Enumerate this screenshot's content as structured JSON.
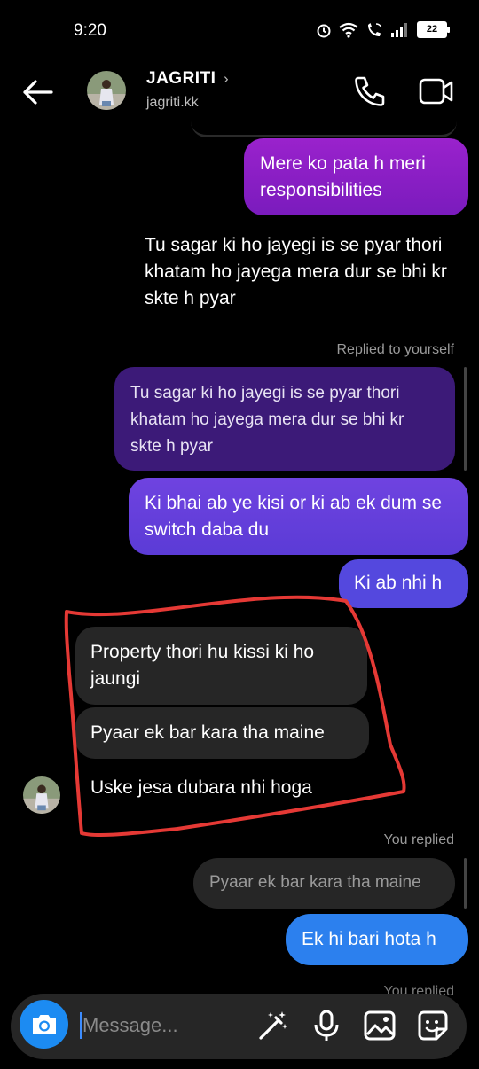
{
  "status_bar": {
    "time": "9:20",
    "battery": "22"
  },
  "header": {
    "name": "JAGRITI",
    "username": "jagriti.kk",
    "chevron": "›"
  },
  "messages": {
    "me1": "Mere ko pata h meri responsibilities",
    "plain": "Tu sagar ki ho jayegi is se pyar thori khatam ho jayega mera dur se bhi kr skte h pyar",
    "replied_to_yourself": "Replied to yourself",
    "quote": "Tu sagar ki ho jayegi is se pyar thori khatam ho jayega mera dur se bhi kr skte h pyar",
    "me2": "Ki bhai ab ye kisi or ki ab ek dum se switch daba du",
    "me3": "Ki ab nhi h",
    "them1": "Property thori hu kissi ki ho jaungi",
    "them2": "Pyaar ek bar kara tha maine",
    "them3": "Uske jesa dubara nhi hoga",
    "you_replied": "You replied",
    "reply_quote": "Pyaar ek bar kara tha maine",
    "me4": "Ek hi bari hota h",
    "you_replied_2": "You replied"
  },
  "composer": {
    "placeholder": "Message..."
  },
  "colors": {
    "accent_blue": "#2c80ee",
    "purple": "#9a22cc",
    "violet": "#5b3bd6",
    "annotation_red": "#e53935"
  }
}
